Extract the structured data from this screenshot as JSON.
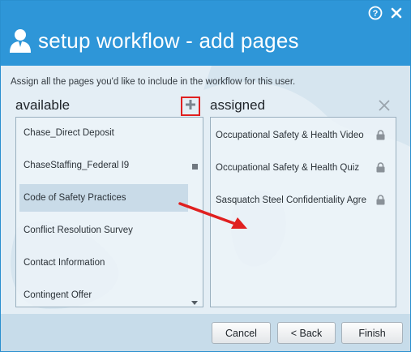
{
  "dialog": {
    "title": "setup workflow - add pages",
    "title_icons": [
      "help-icon",
      "close-icon"
    ]
  },
  "instruction": "Assign all the pages you'd like to include in the workflow for this user.",
  "available": {
    "label": "available",
    "items": [
      {
        "label": "Chase_Direct Deposit",
        "selected": false
      },
      {
        "label": "ChaseStaffing_Federal I9",
        "selected": false
      },
      {
        "label": "Code of Safety Practices",
        "selected": true
      },
      {
        "label": "Conflict Resolution Survey",
        "selected": false
      },
      {
        "label": "Contact Information",
        "selected": false
      },
      {
        "label": "Contingent Offer",
        "selected": false
      }
    ]
  },
  "assigned": {
    "label": "assigned",
    "items": [
      {
        "label": "Occupational Safety & Health Video",
        "locked": true
      },
      {
        "label": "Occupational Safety & Health Quiz",
        "locked": true
      },
      {
        "label": "Sasquatch Steel Confidentiality Agre",
        "locked": true
      }
    ]
  },
  "buttons": {
    "cancel": "Cancel",
    "back": "< Back",
    "finish": "Finish"
  },
  "colors": {
    "titlebar": "#2e96d8",
    "highlight": "#e02020",
    "annotation_arrow": "#e02020"
  }
}
